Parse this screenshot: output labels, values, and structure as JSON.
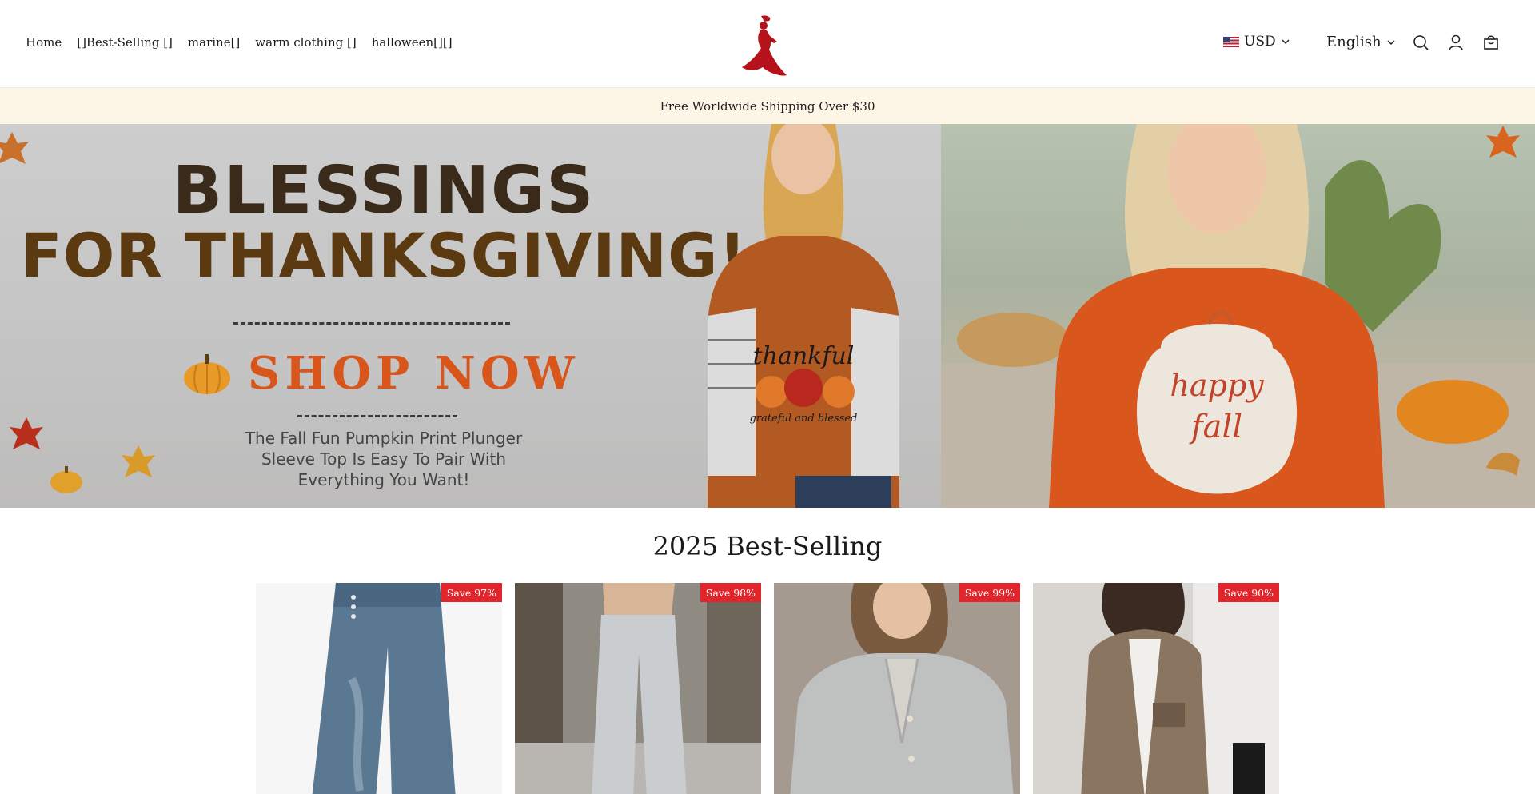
{
  "header": {
    "nav": [
      "Home",
      "[]Best-Selling []",
      "marine[]",
      "warm clothing []",
      "halloween[][]"
    ],
    "currency": "USD",
    "language": "English",
    "icons": [
      "search-icon",
      "account-icon",
      "cart-icon"
    ],
    "flag_icon": "us-flag-icon",
    "logo_icon": "lady-silhouette-logo"
  },
  "announcement": "Free Worldwide Shipping Over $30",
  "hero": {
    "title_line1": "BLESSINGS",
    "title_line2": "FOR THANKSGIVING!",
    "cta": "SHOP NOW",
    "subtitle_lines": [
      "The Fall Fun Pumpkin Print Plunger",
      "Sleeve Top Is Easy To Pair With",
      "Everything You Want!"
    ],
    "shirt1_text": [
      "thankful",
      "grateful and blessed"
    ],
    "shirt2_text": [
      "happy",
      "fall"
    ]
  },
  "section": {
    "title": "2025 Best-Selling"
  },
  "products": [
    {
      "badge": "Save 97%"
    },
    {
      "badge": "Save 98%"
    },
    {
      "badge": "Save 99%"
    },
    {
      "badge": "Save 90%"
    }
  ],
  "colors": {
    "badge": "#e2252b",
    "announcement_bg": "#fdf6e7",
    "logo": "#b5121b",
    "cta": "#d8561b"
  }
}
